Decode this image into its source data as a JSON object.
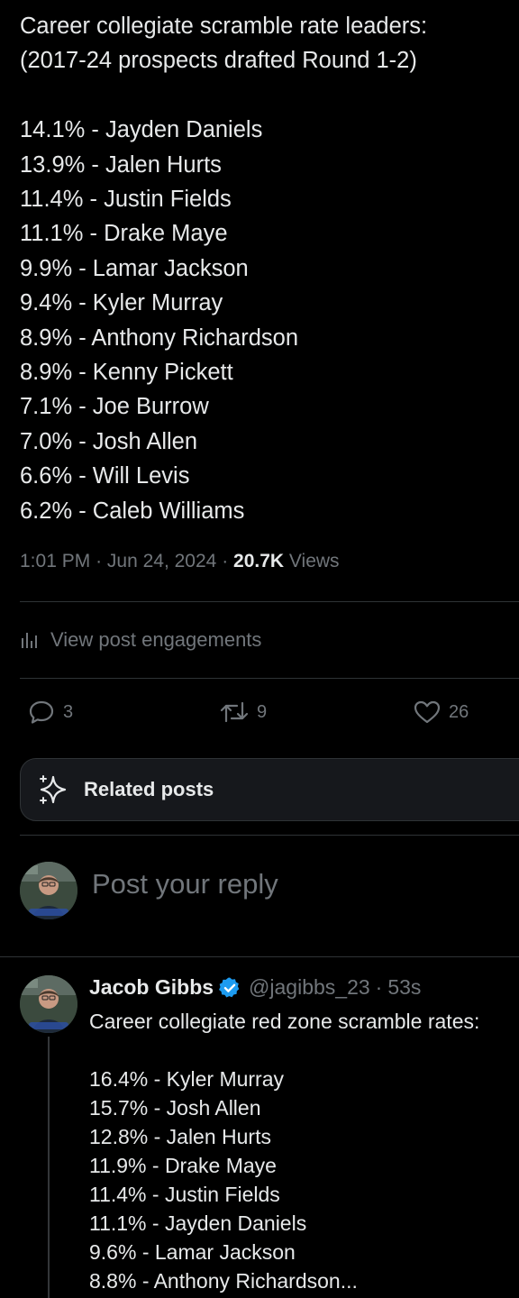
{
  "post": {
    "heading_lines": [
      "Career collegiate scramble rate leaders:",
      "(2017-24 prospects drafted Round 1-2)"
    ],
    "items": [
      "14.1% - Jayden Daniels",
      "13.9% - Jalen Hurts",
      "11.4% - Justin Fields",
      "11.1% - Drake Maye",
      "9.9% - Lamar Jackson",
      "9.4% - Kyler Murray",
      "8.9% - Anthony Richardson",
      "8.9% - Kenny Pickett",
      "7.1% - Joe Burrow",
      "7.0% - Josh Allen",
      "6.6% - Will Levis",
      "6.2% - Caleb Williams"
    ],
    "time": "1:01 PM",
    "separator": "·",
    "date": "Jun 24, 2024",
    "views_count": "20.7K",
    "views_label": "Views"
  },
  "engagements": {
    "label": "View post engagements",
    "icon": "analytics-icon"
  },
  "actions": {
    "replies": "3",
    "reposts": "9",
    "likes": "26"
  },
  "related": {
    "label": "Related posts",
    "icon": "sparkle-icon"
  },
  "compose": {
    "placeholder": "Post your reply"
  },
  "reply": {
    "name": "Jacob Gibbs",
    "handle": "@jagibbs_23",
    "separator": "·",
    "age": "53s",
    "heading": "Career collegiate red zone scramble rates:",
    "items": [
      "16.4% - Kyler Murray",
      "15.7% - Josh Allen",
      "12.8% - Jalen Hurts",
      "11.9% - Drake Maye",
      "11.4% - Justin Fields",
      "11.1% - Jayden Daniels",
      "9.6% - Lamar Jackson",
      "8.8% - Anthony Richardson..."
    ]
  },
  "colors": {
    "background": "#000000",
    "text": "#e7e9ea",
    "muted": "#71767b",
    "border": "#2f3336",
    "verified": "#1d9bf0"
  }
}
